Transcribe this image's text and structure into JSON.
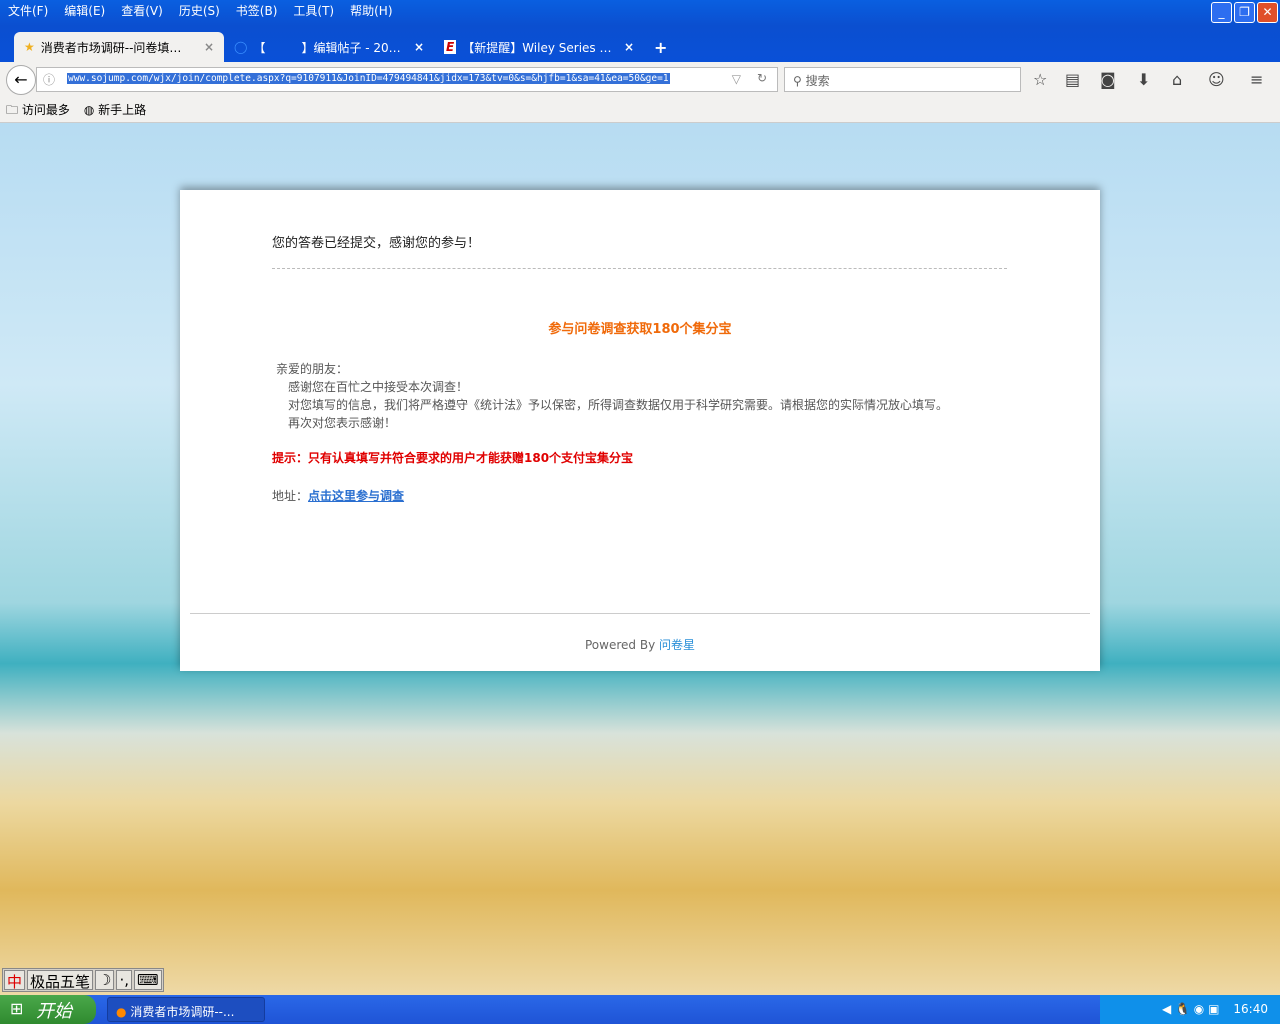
{
  "browser": {
    "menu": [
      "文件(F)",
      "编辑(E)",
      "查看(V)",
      "历史(S)",
      "书签(B)",
      "工具(T)",
      "帮助(H)"
    ],
    "tabs": [
      {
        "label": "消费者市场调研--问卷填…",
        "icon": "star-icon",
        "active": true
      },
      {
        "label": "【　　　】编辑帖子 - 20…",
        "icon": "loading-icon"
      },
      {
        "label": "【新提醒】Wiley Series …",
        "icon": "e-logo-icon"
      }
    ],
    "new_tab": "+",
    "url": "www.sojump.com/wjx/join/complete.aspx?q=9107911&JoinID=479494841&jidx=173&tv=0&s=&hjfb=1&sa=41&ea=50&ge=1",
    "search_placeholder": "搜索",
    "bookmarks": [
      "访问最多",
      "新手上路"
    ]
  },
  "page": {
    "done": "您的答卷已经提交，感谢您的参与！",
    "heading": "参与问卷调查获取180个集分宝",
    "greeting": "亲爱的朋友：",
    "lines": [
      "感谢您在百忙之中接受本次调查！",
      "对您填写的信息，我们将严格遵守《统计法》予以保密，所得调查数据仅用于科学研究需要。请根据您的实际情况放心填写。",
      "再次对您表示感谢！"
    ],
    "tip": "提示：只有认真填写并符合要求的用户才能获赠180个支付宝集分宝",
    "addr_label": "地址：",
    "addr_link": "点击这里参与调查",
    "powered": "Powered By ",
    "brand": "问卷星"
  },
  "taskbar": {
    "ime": [
      "中",
      "极品五笔",
      "☽",
      "·,",
      "⌨"
    ],
    "start": "开始",
    "task": "消费者市场调研--...",
    "clock": "16:40"
  }
}
